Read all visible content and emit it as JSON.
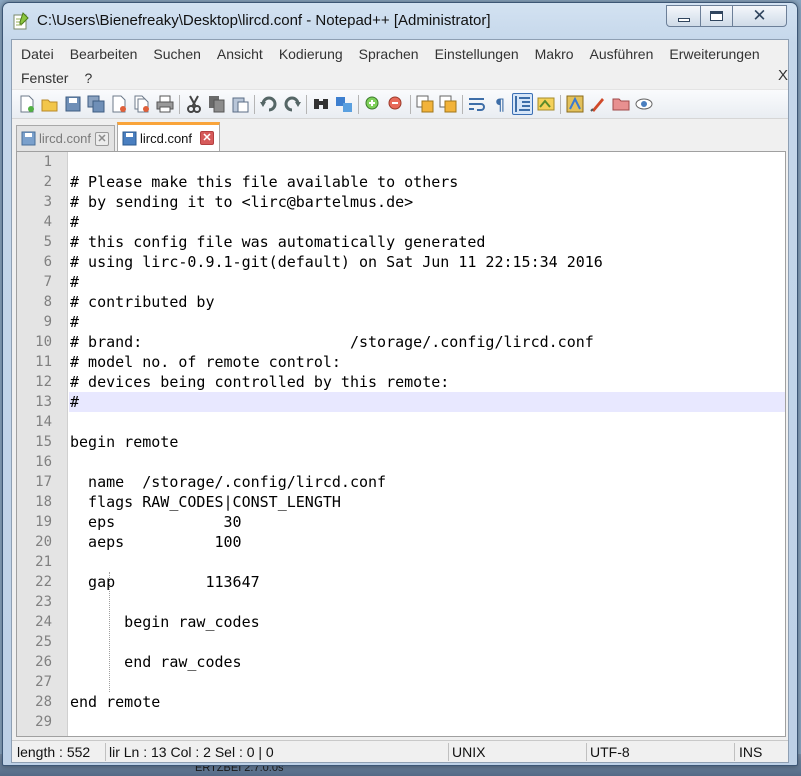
{
  "window": {
    "title": "C:\\Users\\Bienefreaky\\Desktop\\lircd.conf - Notepad++ [Administrator]"
  },
  "menu": {
    "row1": [
      "Datei",
      "Bearbeiten",
      "Suchen",
      "Ansicht",
      "Kodierung",
      "Sprachen",
      "Einstellungen",
      "Makro",
      "Ausführen",
      "Erweiterungen"
    ],
    "row2": [
      "Fenster",
      "?"
    ],
    "close_label": "X"
  },
  "toolbar_icons": [
    "new-file-icon",
    "open-file-icon",
    "save-icon",
    "save-all-icon",
    "close-icon",
    "close-all-icon",
    "print-icon",
    "cut-icon",
    "copy-icon",
    "paste-icon",
    "undo-icon",
    "redo-icon",
    "find-icon",
    "replace-icon",
    "zoom-in-icon",
    "zoom-out-icon",
    "sync-vertical-icon",
    "sync-horizontal-icon",
    "word-wrap-icon",
    "show-all-chars-icon",
    "indent-guide-icon",
    "document-map-icon",
    "function-list-icon",
    "macro-record-icon",
    "folder-workspace-icon",
    "monitor-icon"
  ],
  "tabs": [
    {
      "label": "lircd.conf",
      "active": false
    },
    {
      "label": "lircd.conf",
      "active": true
    }
  ],
  "editor": {
    "current_line": 13,
    "lines": [
      "",
      "# Please make this file available to others",
      "# by sending it to <lirc@bartelmus.de>",
      "#",
      "# this config file was automatically generated",
      "# using lirc-0.9.1-git(default) on Sat Jun 11 22:15:34 2016",
      "#",
      "# contributed by",
      "#",
      "# brand:                       /storage/.config/lircd.conf",
      "# model no. of remote control:",
      "# devices being controlled by this remote:",
      "#",
      "",
      "begin remote",
      "",
      "  name  /storage/.config/lircd.conf",
      "  flags RAW_CODES|CONST_LENGTH",
      "  eps            30",
      "  aeps          100",
      "",
      "  gap          113647",
      "",
      "      begin raw_codes",
      "",
      "      end raw_codes",
      "",
      "end remote",
      ""
    ]
  },
  "status": {
    "length": "length : 552",
    "position": "lir Ln : 13    Col : 2    Sel : 0 | 0",
    "eol": "UNIX",
    "encoding": "UTF-8",
    "mode": "INS"
  },
  "background_peek": "ERTZBEI 2.7.0.0s"
}
